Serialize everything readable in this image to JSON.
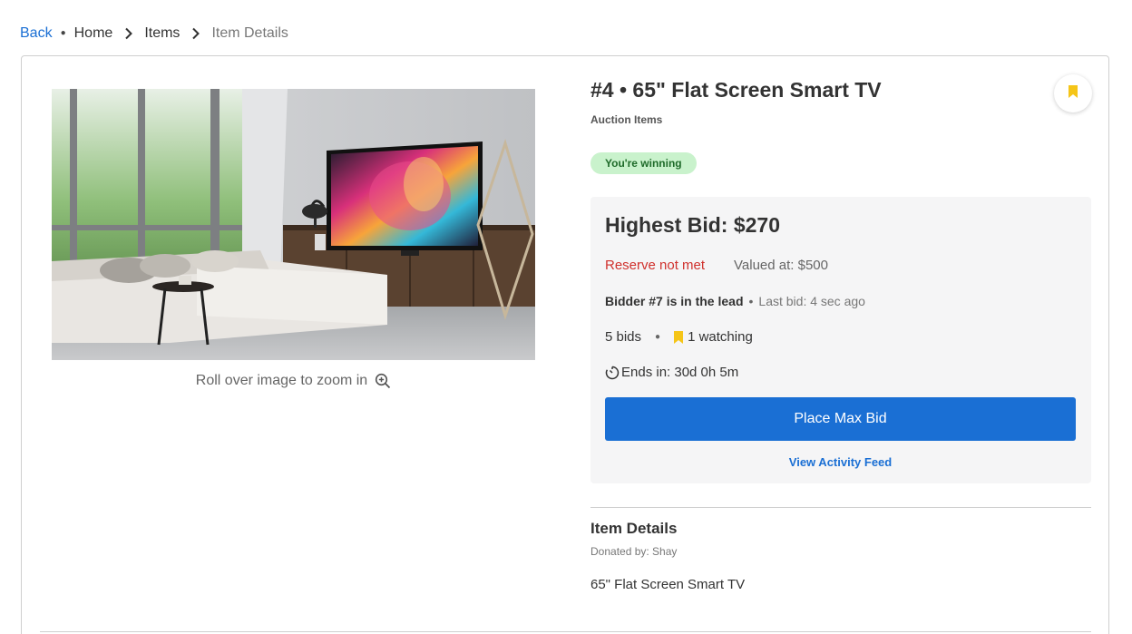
{
  "breadcrumb": {
    "back_label": "Back",
    "items": [
      "Home",
      "Items"
    ],
    "current": "Item Details"
  },
  "item": {
    "title": "#4 • 65\" Flat Screen Smart TV",
    "category": "Auction Items",
    "status": "You're winning",
    "zoom_hint": "Roll over image to zoom in"
  },
  "bid_panel": {
    "highest_bid": "Highest Bid: $270",
    "reserve": "Reserve not met",
    "valued_at": "Valued at: $500",
    "leader": "Bidder #7 is in the lead",
    "last_bid": "Last bid: 4 sec ago",
    "bid_count": "5 bids",
    "watching": "1 watching",
    "ends_in": "Ends in: 30d 0h 5m",
    "place_bid_label": "Place Max Bid",
    "activity_label": "View Activity Feed"
  },
  "details": {
    "heading": "Item Details",
    "donated_by": "Donated by: Shay",
    "description": "65\" Flat Screen Smart TV"
  },
  "icons": {
    "breadcrumb_separator": "chevron-right-icon",
    "zoom": "zoom-in-icon",
    "bookmark": "bookmark-icon",
    "watching": "bookmark-icon",
    "timer": "clock-icon"
  },
  "colors": {
    "accent": "#1a6fd4",
    "reserve_warning": "#d0312d",
    "winning_badge_bg": "#c9f2cc",
    "winning_badge_text": "#1f6b2a",
    "bookmark": "#f5c518"
  }
}
